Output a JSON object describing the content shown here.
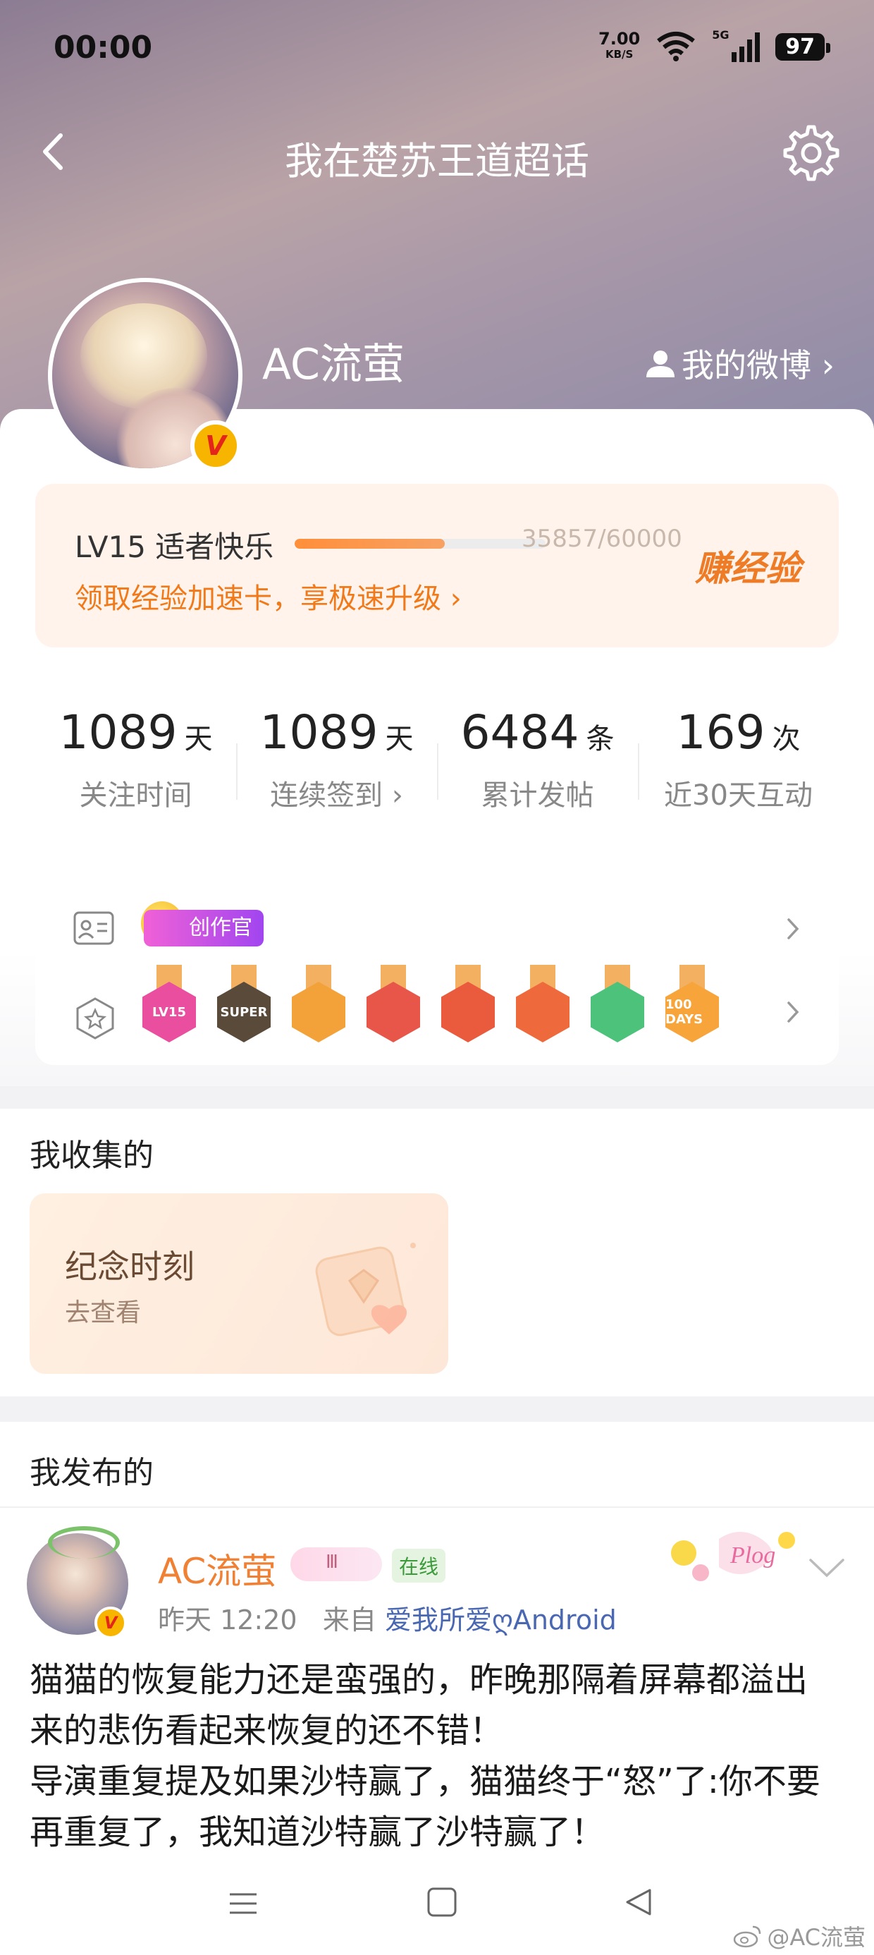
{
  "status_bar": {
    "time": "00:00",
    "net_speed_value": "7.00",
    "net_speed_unit": "KB/S",
    "network": "5G",
    "battery": "97"
  },
  "header": {
    "title": "我在楚苏王道超话",
    "username": "AC流萤",
    "my_weibo": "我的微博 ›"
  },
  "level": {
    "label": "LV15 适者快乐",
    "exp_text": "35857/60000",
    "progress_fraction": 0.5976,
    "link": "领取经验加速卡，享极速升级 ›",
    "earn_button": "赚经验"
  },
  "stats": [
    {
      "value": "1089",
      "unit": "天",
      "label": "关注时间"
    },
    {
      "value": "1089",
      "unit": "天",
      "label": "连续签到 ›"
    },
    {
      "value": "6484",
      "unit": "条",
      "label": "累计发帖"
    },
    {
      "value": "169",
      "unit": "次",
      "label": "近30天互动"
    }
  ],
  "badges": {
    "creator_tag": "创作官",
    "medals": [
      {
        "icon": "lv15-medal",
        "text": "LV15",
        "color": "#ea4e9e"
      },
      {
        "icon": "super-medal",
        "text": "SUPER",
        "color": "#5a4a3a"
      },
      {
        "icon": "crown-medal",
        "text": "",
        "color": "#f3a23a"
      },
      {
        "icon": "mascot-medal-1",
        "text": "",
        "color": "#e8564a"
      },
      {
        "icon": "mascot-medal-2",
        "text": "",
        "color": "#ea5a3c"
      },
      {
        "icon": "mascot-medal-3",
        "text": "",
        "color": "#ee6a3c"
      },
      {
        "icon": "hand-medal",
        "text": "",
        "color": "#4cc27a"
      },
      {
        "icon": "100-days-medal",
        "text": "100 DAYS",
        "color": "#f7a43a"
      }
    ]
  },
  "collected": {
    "title": "我收集的",
    "card_title": "纪念时刻",
    "card_subtitle": "去查看"
  },
  "posts": {
    "title": "我发布的",
    "author": "AC流萤",
    "vip_level": "Ⅲ",
    "online": "在线",
    "time": "昨天 12:20",
    "from_label": "来自",
    "source": "爱我所爱ღAndroid",
    "content": [
      "猫猫的恢复能力还是蛮强的，昨晚那隔着屏幕都溢出来的悲伤看起来恢复的还不错！",
      "导演重复提及如果沙特赢了，猫猫终于“怒”了:你不要再重复了，我知道沙特赢了沙特赢了！"
    ]
  },
  "watermark": "@AC流萤",
  "colors": {
    "accent_orange": "#f07a1a",
    "link_blue": "#4a67b2",
    "author_orange": "#f08033"
  }
}
